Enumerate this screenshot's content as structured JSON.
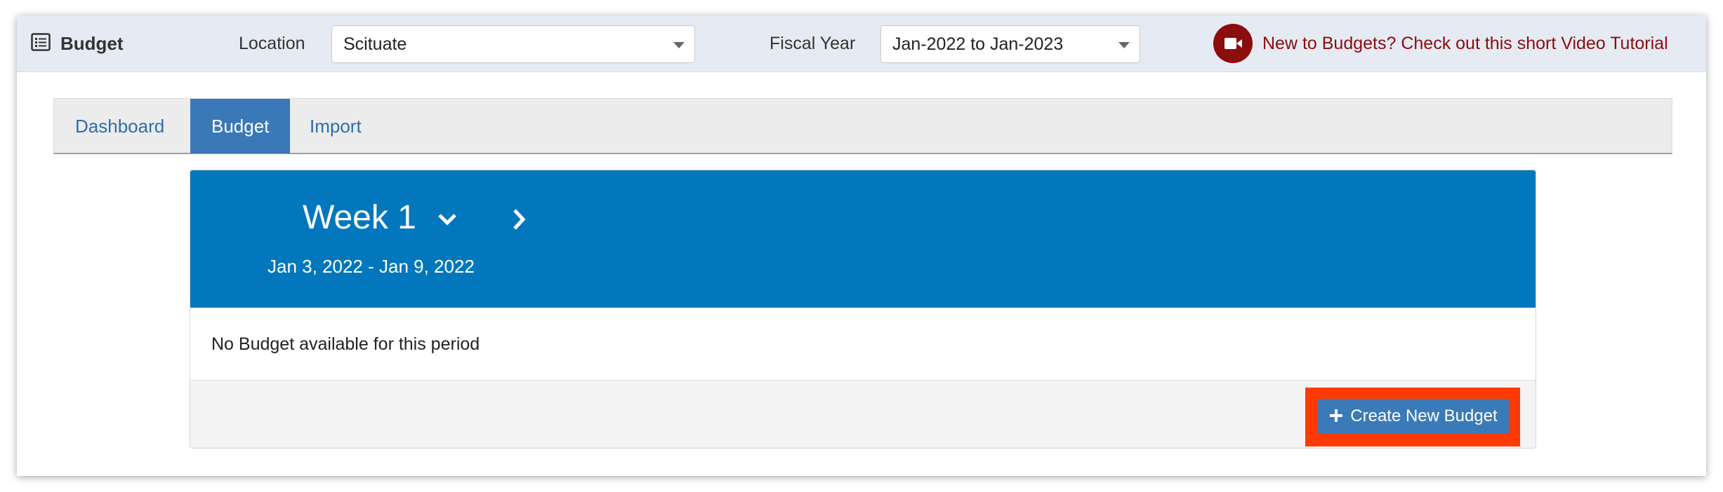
{
  "header": {
    "brand_label": "Budget",
    "location_label": "Location",
    "location_value": "Scituate",
    "fiscal_year_label": "Fiscal Year",
    "fiscal_year_value": "Jan-2022 to Jan-2023",
    "video_link_text": "New to Budgets? Check out this short Video Tutorial",
    "video_color": "#8c0d0d"
  },
  "tabs": [
    {
      "label": "Dashboard",
      "active": false
    },
    {
      "label": "Budget",
      "active": true
    },
    {
      "label": "Import",
      "active": false
    }
  ],
  "period": {
    "week_label": "Week 1",
    "date_range": "Jan 3, 2022 - Jan 9, 2022"
  },
  "content": {
    "empty_message": "No Budget available for this period",
    "create_button_label": "Create New Budget"
  },
  "colors": {
    "accent": "#0277bd",
    "tab_active": "#3a78b7",
    "highlight": "#ff3a00"
  }
}
